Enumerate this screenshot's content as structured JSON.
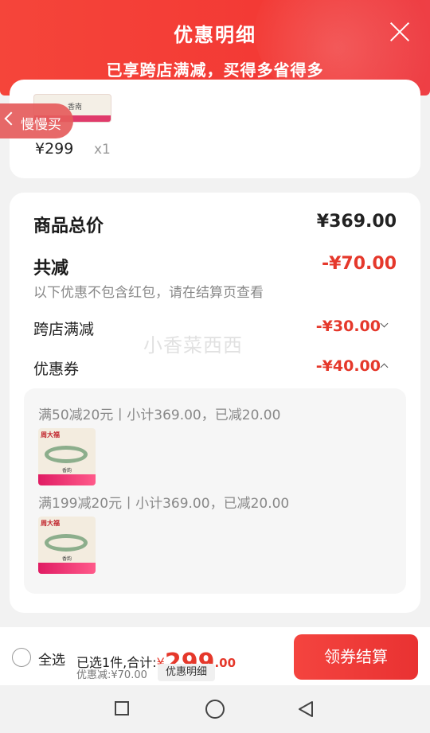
{
  "header": {
    "title": "优惠明细",
    "subtitle": "已享跨店满减，买得多省得多",
    "close_icon": "close-icon"
  },
  "top_item": {
    "thumb_label": "香南",
    "price": "¥299",
    "qty": "x1"
  },
  "slow_buy": {
    "label": "慢慢买",
    "icon": "chevron-left-icon"
  },
  "summary": {
    "total_label": "商品总价",
    "total_value": "¥369.00",
    "reduce_label": "共减",
    "reduce_value": "-¥70.00",
    "note": "以下优惠不包含红包，请在结算页查看",
    "cross_store_label": "跨店满减",
    "cross_store_value": "-¥30.00",
    "coupon_label": "优惠券",
    "coupon_value": "-¥40.00"
  },
  "coupons": [
    {
      "line": "满50减20元丨小计369.00，已减20.00"
    },
    {
      "line": "满199减20元丨小计369.00，已减20.00"
    }
  ],
  "product_thumb": {
    "logo": "周大福",
    "mid": "香韵"
  },
  "watermark": "小香菜西西",
  "bottom": {
    "select_all": "全选",
    "selected_text": "已选1件,合计:",
    "currency": "¥",
    "amount_int": "299",
    "amount_dec": ".00",
    "discount_text": "优惠减:¥70.00",
    "detail_chip": "优惠明细",
    "checkout": "领券结算"
  },
  "colors": {
    "accent": "#e5382b",
    "header": "#f3433a"
  }
}
